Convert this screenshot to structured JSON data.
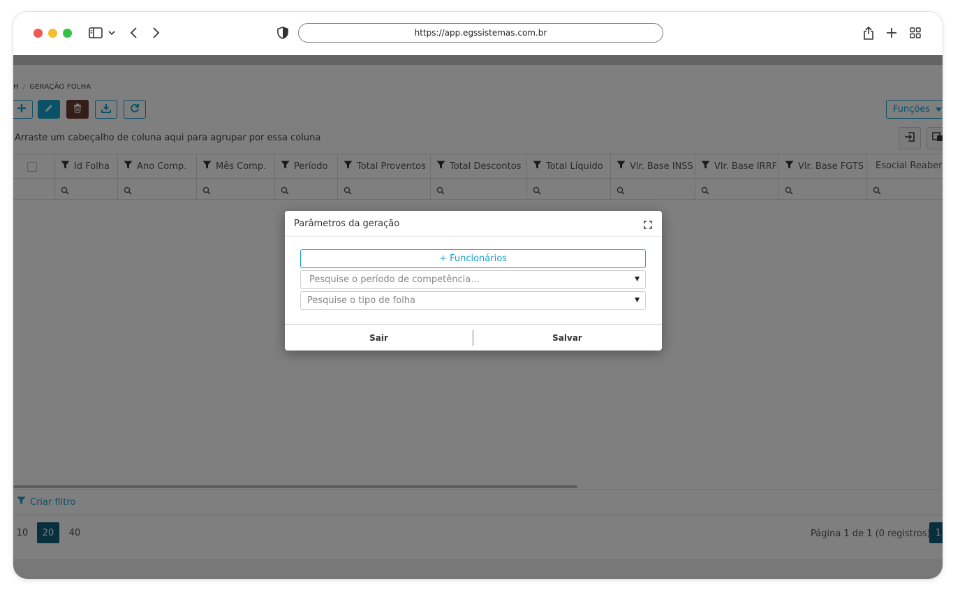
{
  "browser": {
    "url": "https://app.egssistemas.com.br"
  },
  "breadcrumb": {
    "parent": "H",
    "separator": "/",
    "current": "GERAÇÃO FOLHA"
  },
  "toolbar": {
    "funcoes_label": "Funções"
  },
  "grid": {
    "group_hint": "Arraste um cabeçalho de coluna aqui para agrupar por essa coluna",
    "columns": [
      "Id Folha",
      "Ano Comp.",
      "Mês Comp.",
      "Período",
      "Total Proventos",
      "Total Descontos",
      "Total Líquido",
      "Vlr. Base INSS",
      "Vlr. Base IRRF",
      "Vlr. Base FGTS",
      "Esocial Reabertu"
    ],
    "create_filter_label": "Criar filtro"
  },
  "pager": {
    "page_sizes": [
      "10",
      "20",
      "40"
    ],
    "active_page_size": "20",
    "info": "Página 1 de 1 (0 registros)",
    "current_page": "1"
  },
  "modal": {
    "title": "Parâmetros da geração",
    "add_employees_label": "+ Funcionários",
    "period_placeholder": "Pesquise o período de competência...",
    "sheet_type_placeholder": "Pesquise o tipo de folha",
    "exit_label": "Sair",
    "save_label": "Salvar"
  },
  "colors": {
    "accent": "#17a2d0",
    "pager_active": "#0f5e7a",
    "delete_button": "#6b3a35"
  }
}
